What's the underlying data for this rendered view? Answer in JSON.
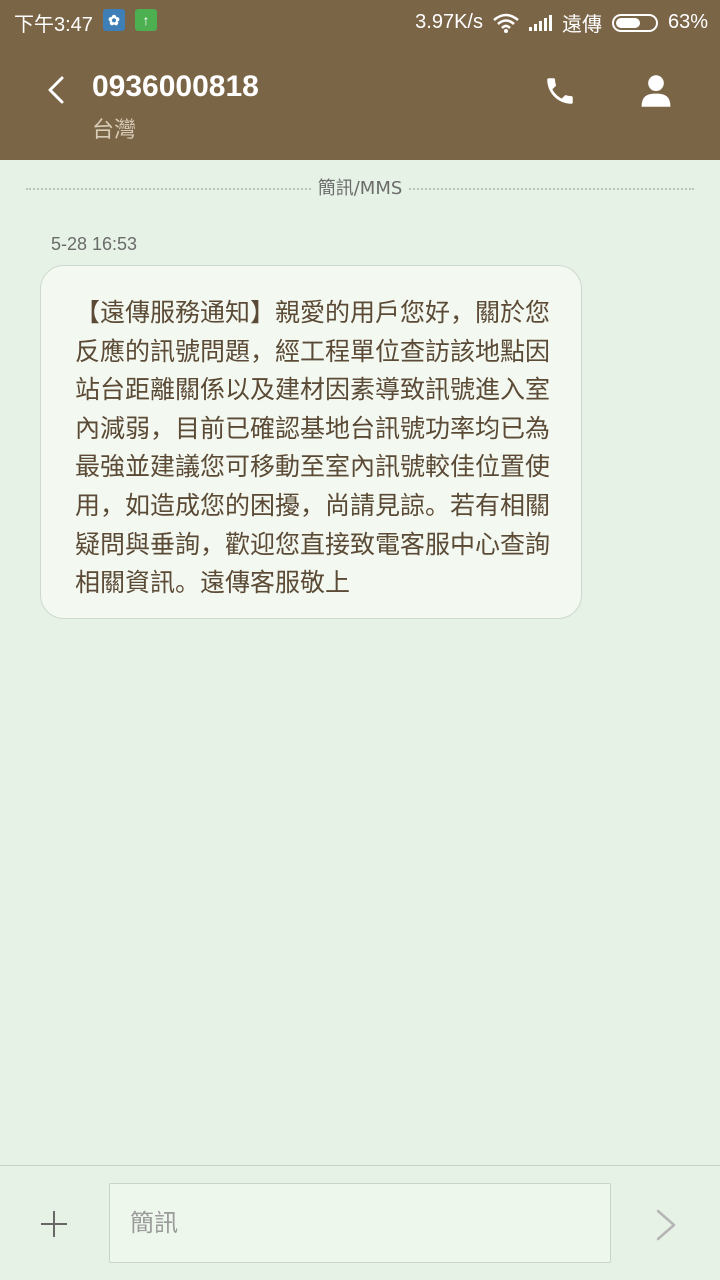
{
  "status_bar": {
    "time": "下午3:47",
    "settings_app_icon": "gear-icon",
    "upload_app_icon": "arrow-up-icon",
    "net_speed": "3.97K/s",
    "carrier": "遠傳",
    "battery_percent": "63%",
    "battery_level": 0.63
  },
  "header": {
    "contact_number": "0936000818",
    "contact_location": "台灣",
    "background_color": "#7b6547"
  },
  "conversation": {
    "divider_label": "簡訊/MMS",
    "message": {
      "timestamp": "5-28 16:53",
      "text": "【遠傳服務通知】親愛的用戶您好，關於您反應的訊號問題，經工程單位查訪該地點因站台距離關係以及建材因素導致訊號進入室內減弱，目前已確認基地台訊號功率均已為最強並建議您可移動至室內訊號較佳位置使用，如造成您的困擾，尚請見諒。若有相關疑問與垂詢，歡迎您直接致電客服中心查詢相關資訊。遠傳客服敬上"
    }
  },
  "composer": {
    "placeholder": "簡訊"
  }
}
